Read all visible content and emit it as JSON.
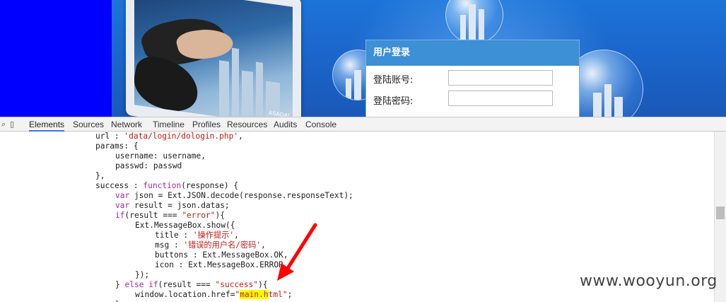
{
  "login": {
    "header": "用户登录",
    "account_label": "登陆账号:",
    "password_label": "登陆密码:"
  },
  "banner": {
    "laptop_brand": "ASADAL"
  },
  "devtools": {
    "tabs": [
      "Elements",
      "Sources",
      "Network",
      "Timeline",
      "Profiles",
      "Resources",
      "Audits",
      "Console"
    ],
    "active_tab": "Elements"
  },
  "code": {
    "l1_pre": "url : ",
    "l1_str": "'data/login/dologin.php'",
    "l1_post": ",",
    "l2": "params: {",
    "l3": "username: username,",
    "l4": "passwd: passwd",
    "l5": "},",
    "l6_pre": "success : ",
    "l6_kw": "function",
    "l6_post": "(response) {",
    "l7_kw": "var",
    "l7_post": " json = Ext.JSON.decode(response.responseText);",
    "l8_kw": "var",
    "l8_post": " result = json.datas;",
    "l9_kw": "if",
    "l9_mid": "(result === ",
    "l9_str": "\"error\"",
    "l9_post": "){",
    "l10": "Ext.MessageBox.show({",
    "l11_pre": "title : ",
    "l11_str": "'操作提示'",
    "l11_post": ",",
    "l12_pre": "msg : ",
    "l12_str": "'错误的用户名/密码'",
    "l12_post": ",",
    "l13": "buttons : Ext.MessageBox.OK,",
    "l14": "icon : Ext.MessageBox.ERROR",
    "l15": "});",
    "l16_pre": "} ",
    "l16_kw1": "else",
    "l16_sp": " ",
    "l16_kw2": "if",
    "l16_mid": "(result === ",
    "l16_str": "\"success\"",
    "l16_post": "){",
    "l17_pre": "window.location.href=",
    "l17_q1": "\"",
    "l17_hl": "main.h",
    "l17_str": "tml\"",
    "l17_post": ";",
    "l18": "}"
  },
  "annotation": {
    "arrow_color": "#ff0000"
  },
  "watermark": "www.wooyun.org",
  "colors": {
    "keyword": "#a626a4",
    "string": "#c41a16",
    "highlight": "#ffff00",
    "login_header": "#3d8fd6"
  }
}
